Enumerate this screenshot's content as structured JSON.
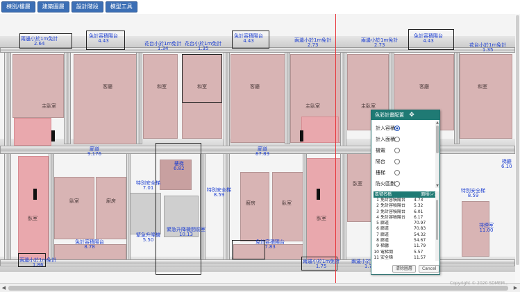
{
  "toolbar": {
    "buttons": [
      "棟別/樓層",
      "建築圖層",
      "設計階段",
      "模型工具"
    ]
  },
  "plan": {
    "labels": [
      {
        "t": "兩邊小於1m免計",
        "v": "2.64"
      },
      {
        "t": "免計容積陽台",
        "v": "4.43"
      },
      {
        "t": "花台小於1m免計",
        "v": "1.34"
      },
      {
        "t": "花台小於1m免計",
        "v": "1.35"
      },
      {
        "t": "免計容積陽台",
        "v": "4.43"
      },
      {
        "t": "兩邊小於1m免計",
        "v": "2.73"
      },
      {
        "t": "兩邊小於1m免計",
        "v": "2.73"
      },
      {
        "t": "免計容積陽台",
        "v": "4.43"
      },
      {
        "t": "花台小於1m免計",
        "v": "1.35"
      },
      {
        "t": "梯廳",
        "v": "6.10"
      },
      {
        "t": "廊道",
        "v": "9.176"
      },
      {
        "t": "廊道",
        "v": "87.83"
      },
      {
        "t": "樓梯",
        "v": "6.82"
      },
      {
        "t": "特別安全梯",
        "v": "7.01"
      },
      {
        "t": "特別安全梯",
        "v": "8.59"
      },
      {
        "t": "特別安全梯",
        "v": "8.59"
      },
      {
        "t": "緊急升降機",
        "v": "5.50"
      },
      {
        "t": "緊急升降機間前室",
        "v": "10.13"
      },
      {
        "t": "免計容積陽台",
        "v": "8.78"
      },
      {
        "t": "免計容積陽台",
        "v": "7.83"
      },
      {
        "t": "兩邊小於1m免計",
        "v": "1.86"
      },
      {
        "t": "兩邊小於1m免計",
        "v": "1.75"
      },
      {
        "t": "兩邊小於1m免計",
        "v": "1.75"
      },
      {
        "t": "排煙室",
        "v": "11.00"
      }
    ],
    "room_names": [
      "主臥室",
      "客廳",
      "和室",
      "和室",
      "客廳",
      "主臥室",
      "主臥室",
      "客廳",
      "和室",
      "臥室",
      "廚房",
      "臥室",
      "廚房",
      "臥室",
      "臥室",
      "臥室"
    ],
    "copyright": "Copyright © 2020 SDMEM..."
  },
  "panel": {
    "title": "色彩計畫配置",
    "categories": [
      {
        "label": "計入容積",
        "selected": true
      },
      {
        "label": "計入面積",
        "selected": false
      },
      {
        "label": "機電",
        "selected": false
      },
      {
        "label": "陽台",
        "selected": false
      },
      {
        "label": "樓梯",
        "selected": false
      },
      {
        "label": "防火區劃",
        "selected": false
      }
    ],
    "table": {
      "col_name": "區號名稱",
      "col_area": "面積(✓)",
      "rows": [
        {
          "n": "1",
          "name": "免計容積陽台",
          "area": "4.73"
        },
        {
          "n": "2",
          "name": "免計容積陽台",
          "area": "5.32"
        },
        {
          "n": "3",
          "name": "免計容積陽台",
          "area": "6.01"
        },
        {
          "n": "4",
          "name": "免計容積陽台",
          "area": "6.17"
        },
        {
          "n": "5",
          "name": "廊道",
          "area": "70.97"
        },
        {
          "n": "6",
          "name": "廊道",
          "area": "70.83"
        },
        {
          "n": "7",
          "name": "廊道",
          "area": "54.32"
        },
        {
          "n": "8",
          "name": "廊道",
          "area": "54.67"
        },
        {
          "n": "9",
          "name": "梯廳",
          "area": "11.79"
        },
        {
          "n": "10",
          "name": "電梯間",
          "area": "5.57"
        },
        {
          "n": "11",
          "name": "安全梯",
          "area": "11.57"
        }
      ]
    },
    "btn_clear": "清除圖層",
    "btn_cancel": "Cancel"
  }
}
